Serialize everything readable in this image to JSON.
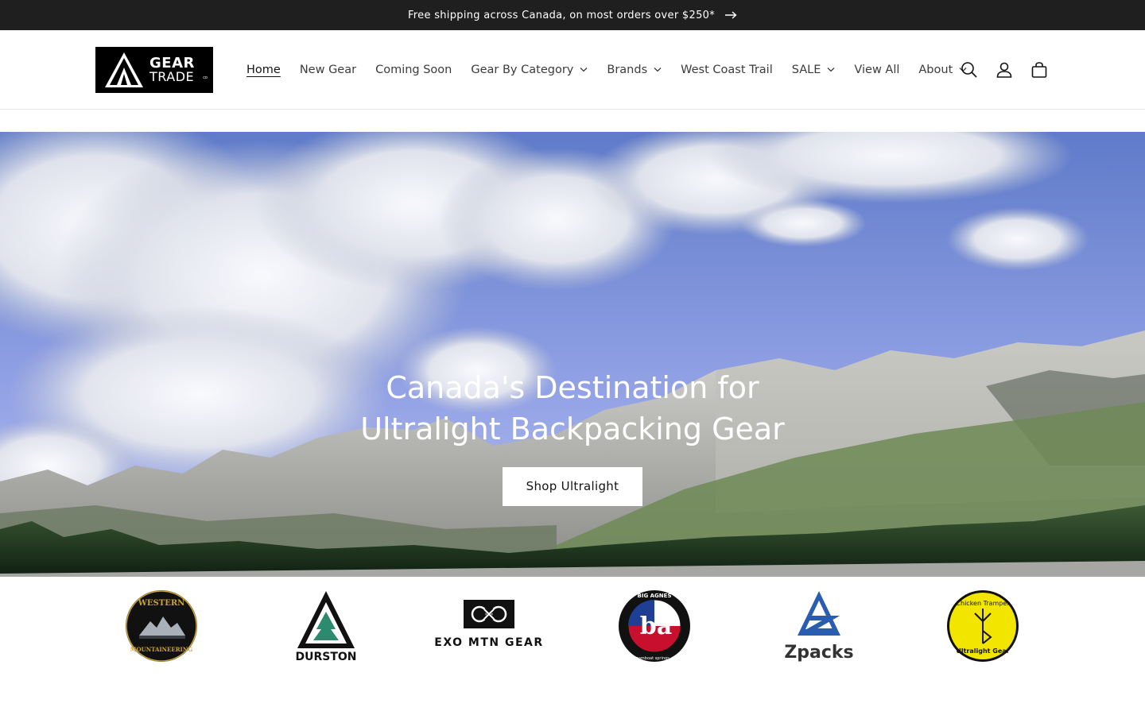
{
  "announcement": {
    "text": "Free shipping across Canada, on most orders over $250*",
    "arrow_icon": "arrow-right-icon"
  },
  "header": {
    "logo": {
      "line1": "GEAR",
      "line2": "TRADE",
      "suffix": "co"
    },
    "nav": [
      {
        "label": "Home",
        "active": true,
        "has_dropdown": false
      },
      {
        "label": "New Gear",
        "active": false,
        "has_dropdown": false
      },
      {
        "label": "Coming Soon",
        "active": false,
        "has_dropdown": false
      },
      {
        "label": "Gear By Category",
        "active": false,
        "has_dropdown": true
      },
      {
        "label": "Brands",
        "active": false,
        "has_dropdown": true
      },
      {
        "label": "West Coast Trail",
        "active": false,
        "has_dropdown": false
      },
      {
        "label": "SALE",
        "active": false,
        "has_dropdown": true
      },
      {
        "label": "View All",
        "active": false,
        "has_dropdown": false
      },
      {
        "label": "About",
        "active": false,
        "has_dropdown": true
      }
    ],
    "icons": [
      "search-icon",
      "account-icon",
      "cart-icon"
    ]
  },
  "hero": {
    "title": "Canada's Destination for Ultralight Backpacking Gear",
    "button_label": "Shop Ultralight"
  },
  "brands": [
    {
      "name": "Western Mountaineering",
      "logo_text_top": "WESTERN",
      "logo_text_bottom": "MOUNTAINEERING"
    },
    {
      "name": "Durston",
      "logo_text": "DURSTON"
    },
    {
      "name": "EXO MTN GEAR",
      "logo_text": "EXO MTN GEAR"
    },
    {
      "name": "Big Agnes",
      "logo_text_top": "BIG AGNES",
      "logo_mark": "ba",
      "logo_text_bottom": "steamboat springs, co"
    },
    {
      "name": "Zpacks",
      "logo_text": "Zpacks"
    },
    {
      "name": "Chicken Tramper Ultralight Gear",
      "logo_text_top": "Chicken Tramper",
      "logo_text_bottom": "Ultralight Gear"
    }
  ],
  "colors": {
    "announcement_bg": "#1f1f1f",
    "text_dark": "#121212",
    "nav_text": "#3b3b3b",
    "hero_sky": "#8a9be0"
  }
}
